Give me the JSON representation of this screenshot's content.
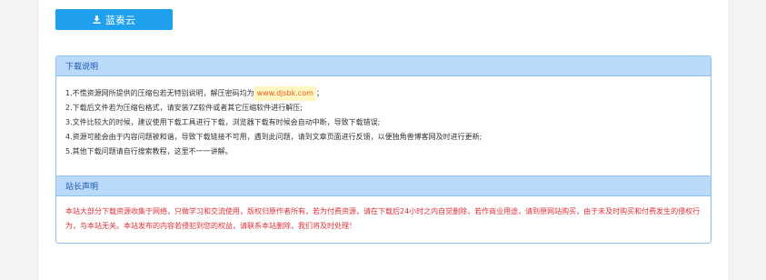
{
  "download": {
    "button_label": "蓝奏云",
    "icon": "download-icon"
  },
  "notes": {
    "title": "下载说明",
    "line1_prefix": "1.不慌资源网所提供的压缩包若无特别说明，解压密码均为",
    "line1_password": "www.djsbk.com",
    "line1_suffix": "；",
    "lines": [
      "2.下载后文件若为压缩包格式，请安装7Z软件或者其它压缩软件进行解压;",
      "3.文件比较大的时候，建议使用下载工具进行下载，浏览器下载有时候会自动中断，导致下载错误;",
      "4.资源可能会由于内容问题被和谐，导致下载链接不可用，遇到此问题，请到文章页面进行反馈，以便独角兽博客网及时进行更新;",
      "5.其他下载问题请自行搜索教程，这里不一一讲解。"
    ]
  },
  "declaration": {
    "title": "站长声明",
    "text": "本站大部分下载资源收集于网络，只做学习和交流使用，版权归原作者所有，若为付费资源，请在下载后24小时之内自觉删除，若作商业用途，请到原网站购买，由于未及时购买和付费发生的侵权行为，与本站无关。本站发布的内容若侵犯到您的权益，请联系本站删除，我们将及时处理！"
  },
  "colors": {
    "button": "#1ea0ec",
    "panel_header": "#b9dafa",
    "panel_border": "#8fc1ef",
    "declaration_text": "#e0303a",
    "password_text": "#e85d1b"
  }
}
